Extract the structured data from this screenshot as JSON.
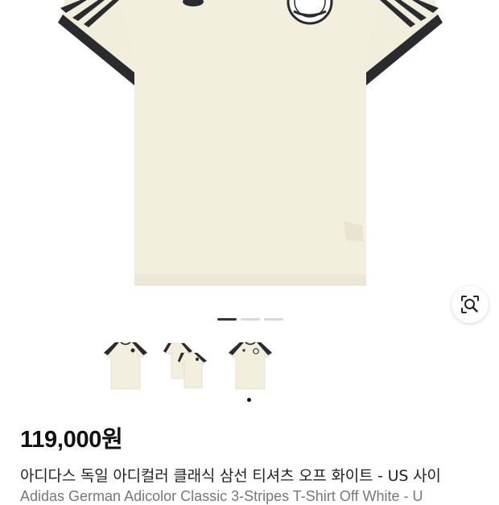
{
  "product": {
    "price": "119,000원",
    "title": "아디다스 독일 아디컬러 클래식 삼선 티셔츠 오프 화이트 - US 사이",
    "subtitle": "Adidas German Adicolor Classic 3-Stripes T-Shirt Off White - U"
  },
  "gallery": {
    "slide_count": 3,
    "active_slide": 1,
    "thumbnails": [
      "jersey-front",
      "jersey-pair",
      "jersey-front-crest"
    ],
    "selected_thumbnail": 3
  },
  "icons": {
    "lens": "image-search-icon"
  },
  "colors": {
    "shirt": "#f3efdf",
    "trim": "#2b2b2f",
    "stripes": "#ffffff"
  }
}
